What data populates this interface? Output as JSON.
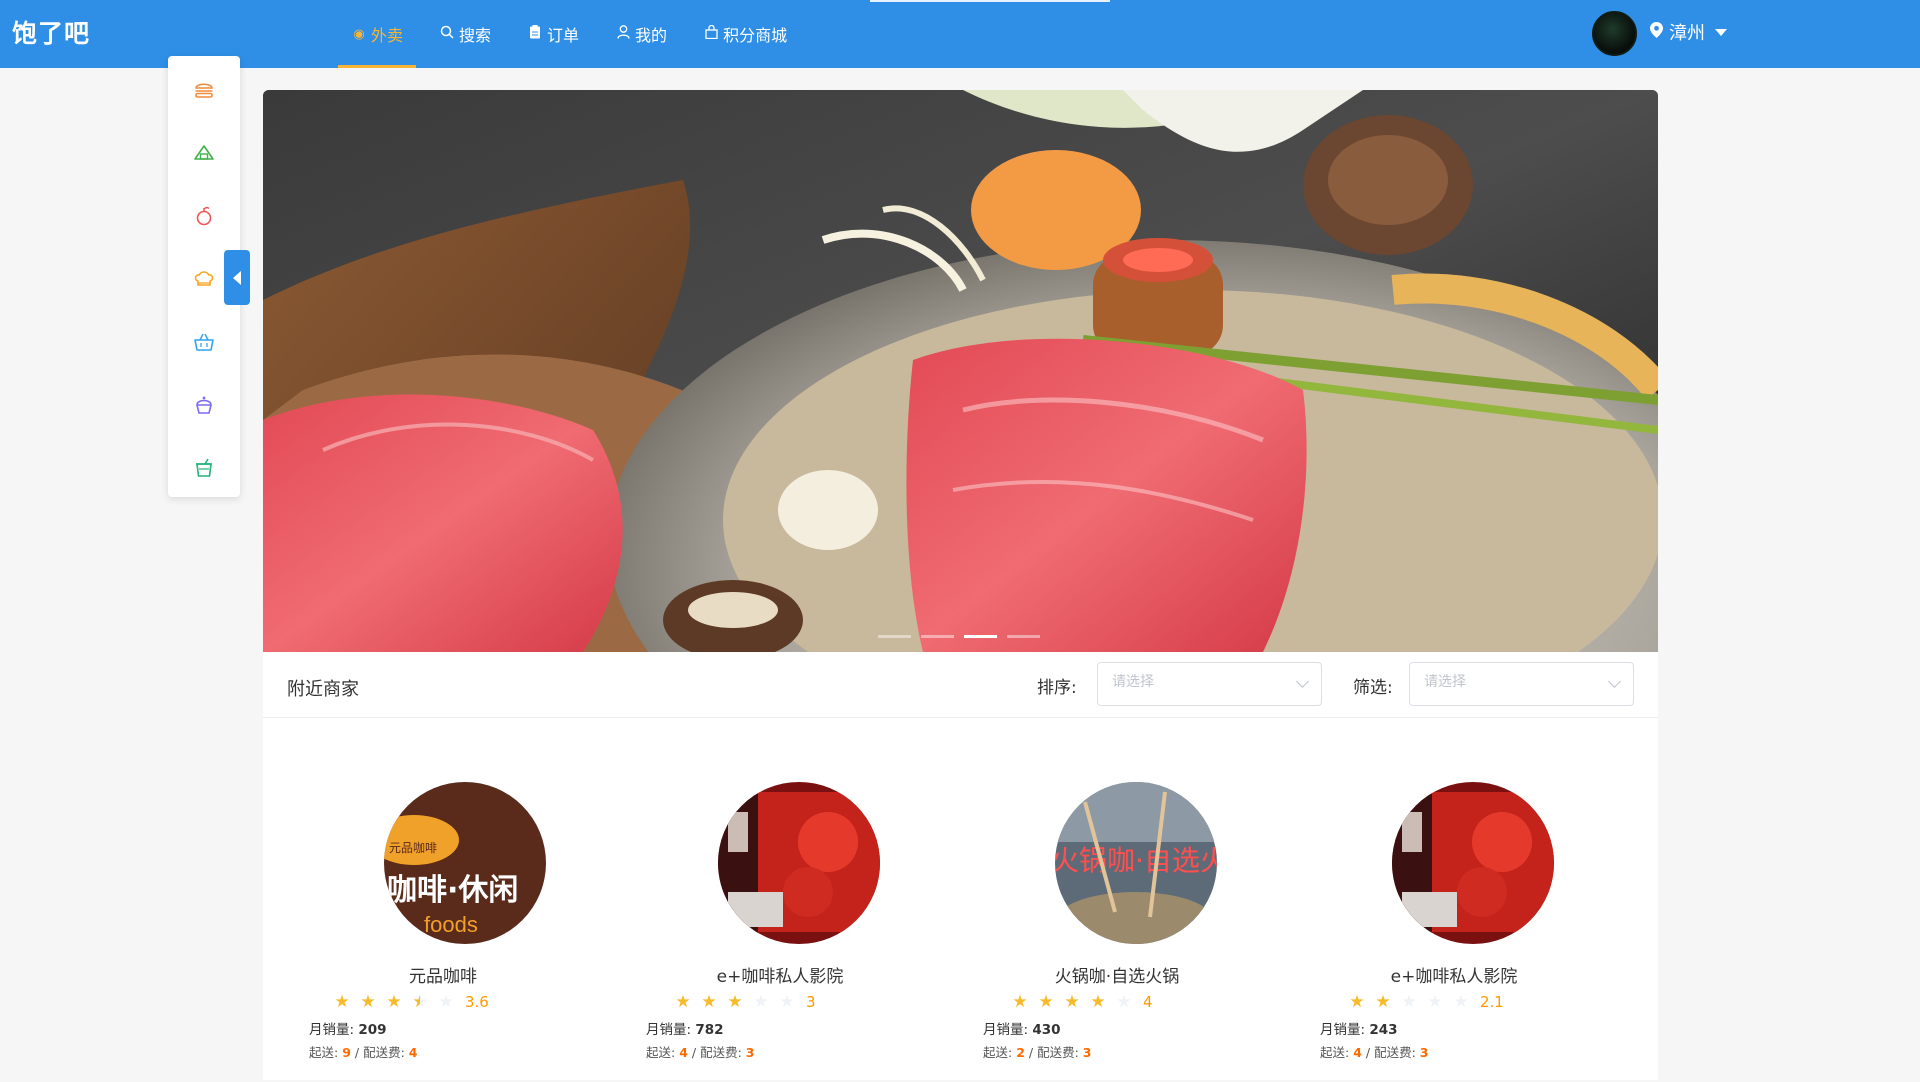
{
  "app": {
    "title": "饱了吧"
  },
  "nav": {
    "items": [
      {
        "label": "外卖",
        "icon": "compass-icon",
        "active": true
      },
      {
        "label": "搜索",
        "icon": "search-icon"
      },
      {
        "label": "订单",
        "icon": "order-icon"
      },
      {
        "label": "我的",
        "icon": "user-icon"
      },
      {
        "label": "积分商城",
        "icon": "shop-bag-icon"
      }
    ],
    "accent": "#f7b538",
    "bar_color": "#2f8fe6"
  },
  "location": {
    "city": "漳州",
    "icon": "location-pin-icon"
  },
  "sidebar": {
    "items": [
      {
        "icon": "burger-icon",
        "color": "#f08a3c"
      },
      {
        "icon": "onigiri-icon",
        "color": "#3fb24a"
      },
      {
        "icon": "fruit-icon",
        "color": "#f05454"
      },
      {
        "icon": "chef-hat-icon",
        "color": "#f5a623"
      },
      {
        "icon": "basket-icon",
        "color": "#33a3f0"
      },
      {
        "icon": "cupcake-icon",
        "color": "#7b6cf0"
      },
      {
        "icon": "drink-cup-icon",
        "color": "#22b27a"
      }
    ],
    "collapse_icon": "caret-left-icon"
  },
  "banner": {
    "slides": 4,
    "active_slide": 3
  },
  "nearby": {
    "title": "附近商家",
    "sort_label": "排序:",
    "sort_placeholder": "请选择",
    "filter_label": "筛选:",
    "filter_placeholder": "请选择"
  },
  "shops": [
    {
      "name": "元品咖啡",
      "rating": 3.6,
      "rating_text": "3.6",
      "sales_label": "月销量:",
      "sales": "209",
      "min_label": "起送:",
      "min": "9",
      "fee_label": "配送费:",
      "fee": "4",
      "logo_text": "咖啡·休闲",
      "logo_sub": "foods"
    },
    {
      "name": "e+咖啡私人影院",
      "rating": 3,
      "rating_text": "3",
      "sales_label": "月销量:",
      "sales": "782",
      "min_label": "起送:",
      "min": "4",
      "fee_label": "配送费:",
      "fee": "3"
    },
    {
      "name": "火锅咖·自选火锅",
      "rating": 4,
      "rating_text": "4",
      "sales_label": "月销量:",
      "sales": "430",
      "min_label": "起送:",
      "min": "2",
      "fee_label": "配送费:",
      "fee": "3",
      "logo_text": "火锅咖·自选火"
    },
    {
      "name": "e+咖啡私人影院",
      "rating": 2.1,
      "rating_text": "2.1",
      "sales_label": "月销量:",
      "sales": "243",
      "min_label": "起送:",
      "min": "4",
      "fee_label": "配送费:",
      "fee": "3"
    }
  ]
}
